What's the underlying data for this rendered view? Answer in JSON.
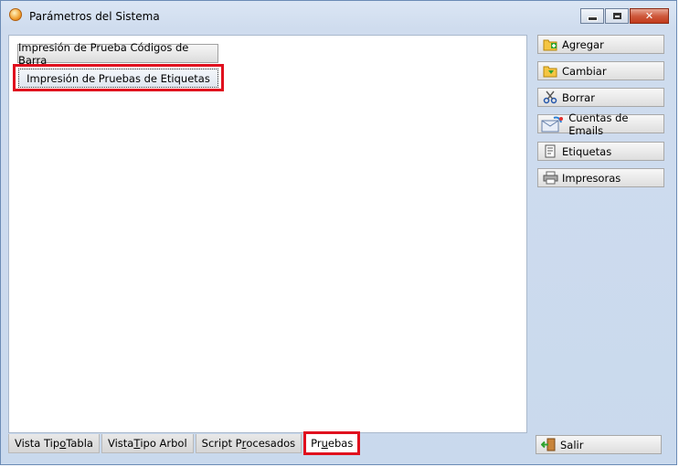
{
  "window": {
    "title": "Parámetros del Sistema",
    "controls": {
      "close": "✕"
    }
  },
  "content": {
    "buttons": [
      {
        "label": "Impresión de Prueba Códigos de Barra"
      },
      {
        "label": "Impresión de Pruebas de Etiquetas",
        "highlighted": true
      }
    ]
  },
  "tabs": [
    {
      "pre": "Vista Tip",
      "u": "o",
      "post": " Tabla"
    },
    {
      "pre": "Vista ",
      "u": "T",
      "post": "ipo Arbol"
    },
    {
      "pre": "Script P",
      "u": "r",
      "post": "ocesados"
    },
    {
      "pre": "Pr",
      "u": "u",
      "post": "ebas",
      "active": true,
      "highlighted": true
    }
  ],
  "side_buttons": [
    {
      "label": "Agregar",
      "icon": "add-folder-icon"
    },
    {
      "label": "Cambiar",
      "icon": "change-folder-icon"
    },
    {
      "label": "Borrar",
      "icon": "scissors-icon"
    },
    {
      "label": "Cuentas de Emails",
      "icon": "email-accounts-icon"
    },
    {
      "label": "Etiquetas",
      "icon": "labels-icon"
    },
    {
      "label": "Impresoras",
      "icon": "printer-icon"
    }
  ],
  "exit_button": {
    "label": "Salir",
    "icon": "exit-door-icon"
  },
  "colors": {
    "highlight": "#e0101e",
    "window_frame": "#6b8bb5"
  }
}
